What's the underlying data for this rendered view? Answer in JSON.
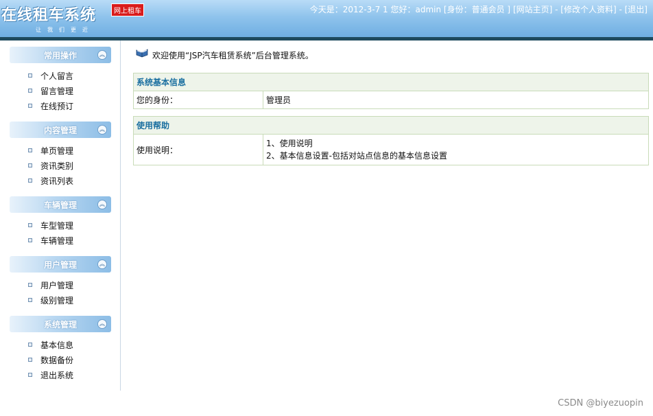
{
  "header": {
    "logo_title": "在线租车系统",
    "logo_badge": "网上租车",
    "logo_slogan": "让我们更近",
    "date_prefix": "今天是：",
    "date": "2012-3-7 1",
    "greeting": "您好：admin",
    "role": "[身份：普通会员 ]",
    "home_link": "[网站主页]",
    "sep": " - ",
    "profile_link": "[修改个人资料]",
    "logout_link": "[退出]"
  },
  "sidebar": {
    "groups": [
      {
        "title": "常用操作",
        "items": [
          "个人留言",
          "留言管理",
          "在线预订"
        ]
      },
      {
        "title": "内容管理",
        "items": [
          "单页管理",
          "资讯类别",
          "资讯列表"
        ]
      },
      {
        "title": "车辆管理",
        "items": [
          "车型管理",
          "车辆管理"
        ]
      },
      {
        "title": "用户管理",
        "items": [
          "用户管理",
          "级别管理"
        ]
      },
      {
        "title": "系统管理",
        "items": [
          "基本信息",
          "数据备份",
          "退出系统"
        ]
      }
    ],
    "toggle_glyph": "︽"
  },
  "main": {
    "welcome": "欢迎使用“JSP汽车租赁系统”后台管理系统。",
    "basic_info": {
      "title": "系统基本信息",
      "label": "您的身份：",
      "value": "管理员"
    },
    "help": {
      "title": "使用帮助",
      "label": "使用说明：",
      "lines": [
        "1、使用说明",
        "2、基本信息设置-包括对站点信息的基本信息设置"
      ]
    }
  },
  "watermark": "CSDN @biyezuopin",
  "icons": {
    "welcome": "book-icon",
    "bullet": "square-bullet-icon",
    "toggle": "collapse-icon"
  }
}
